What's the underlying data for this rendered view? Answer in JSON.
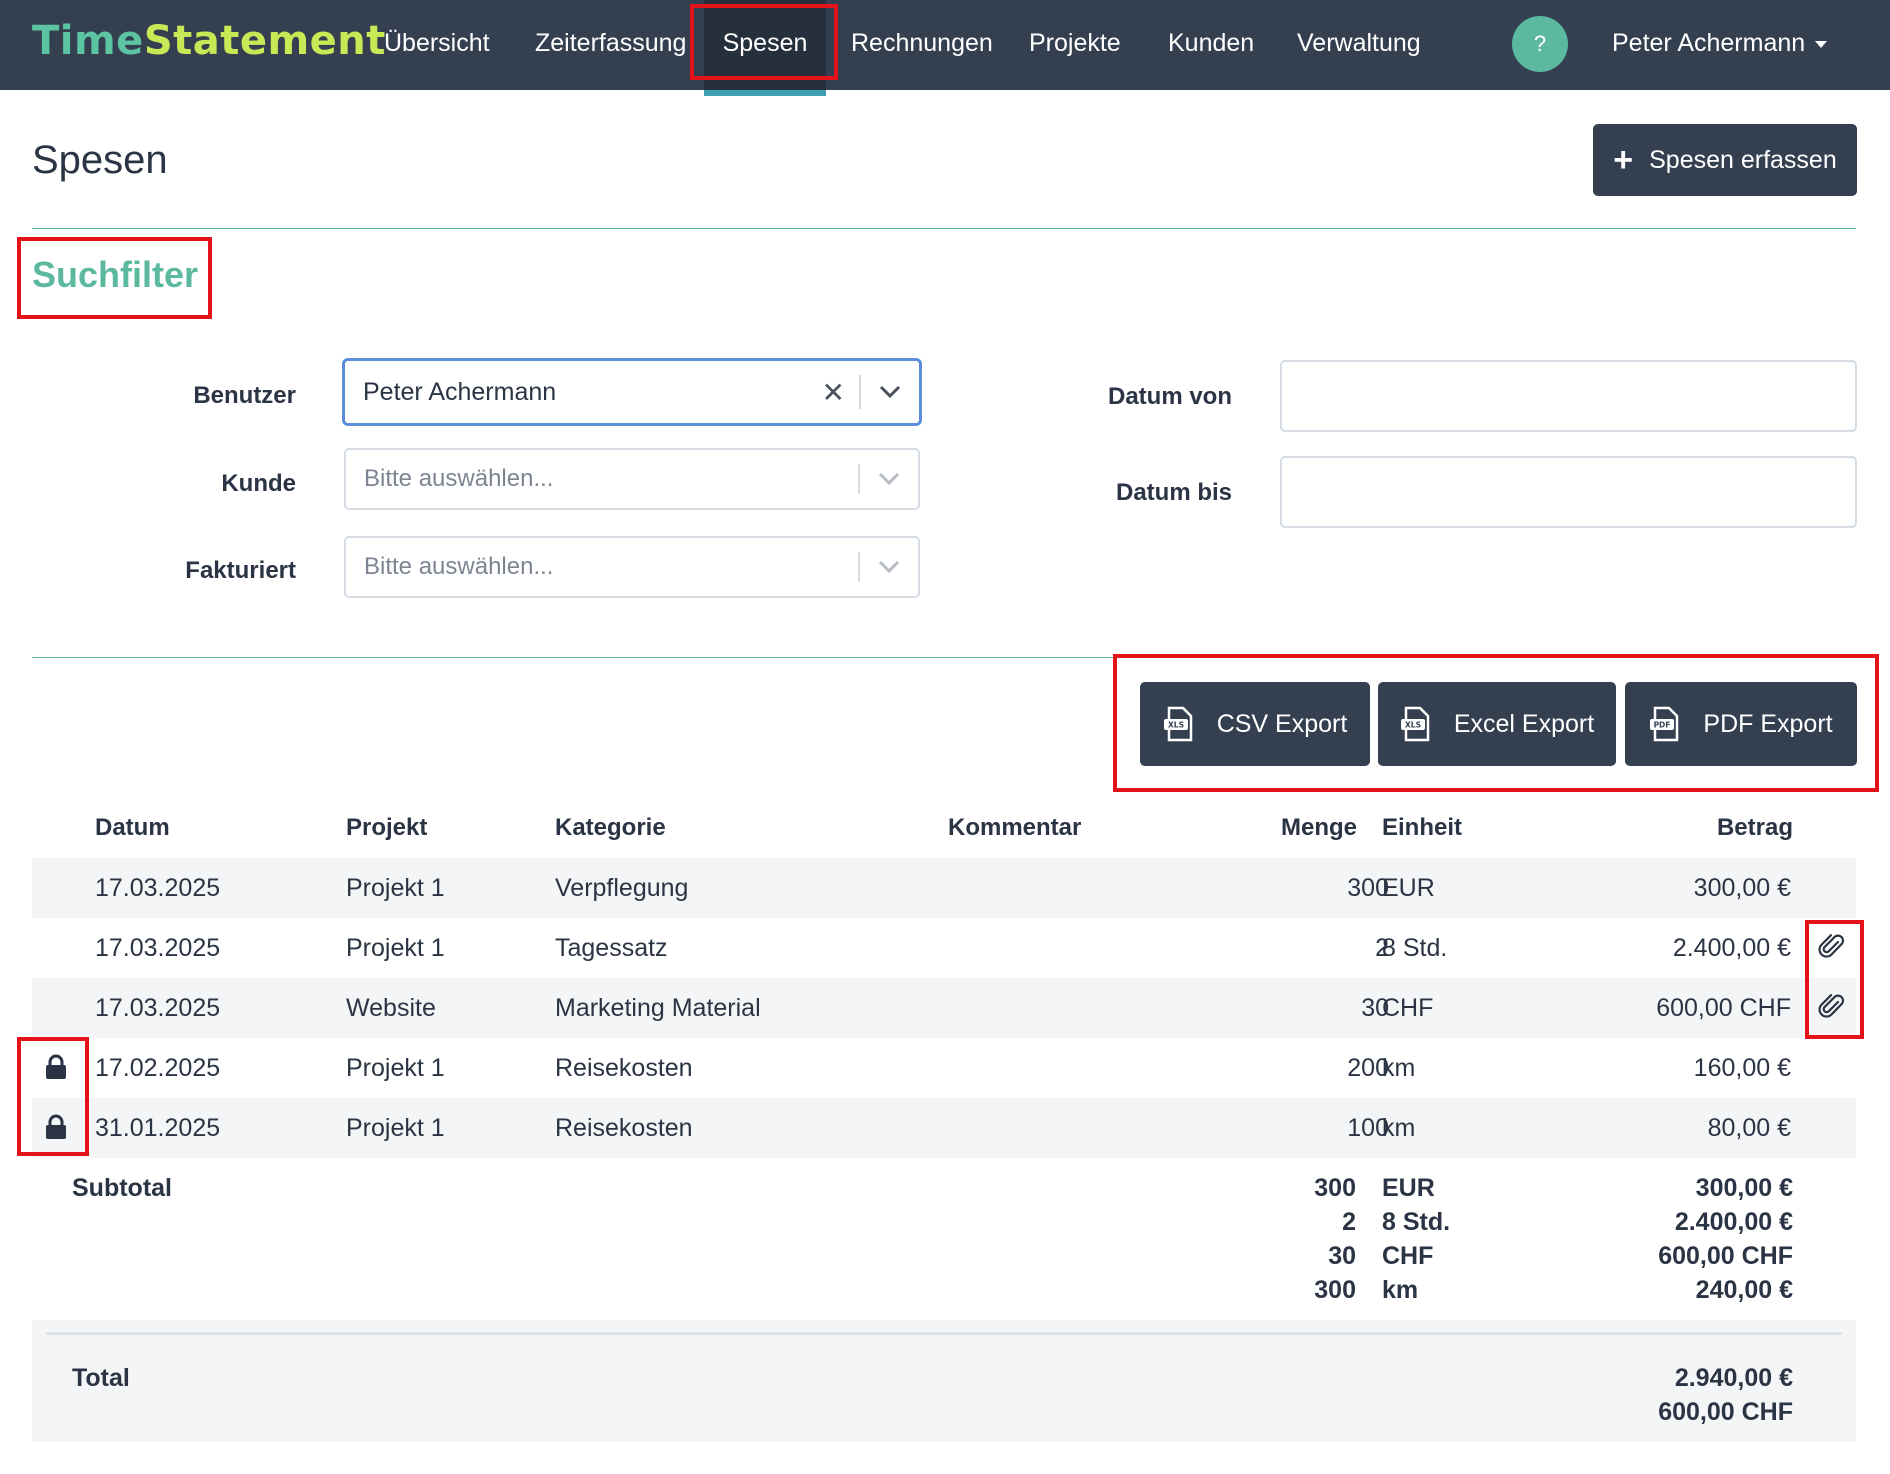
{
  "brand": {
    "part1": "Time",
    "part2": "Statement"
  },
  "nav": {
    "items": [
      "Übersicht",
      "Zeiterfassung",
      "Spesen",
      "Rechnungen",
      "Projekte",
      "Kunden",
      "Verwaltung"
    ],
    "active": "Spesen",
    "help_label": "?",
    "user_name": "Peter Achermann"
  },
  "page": {
    "title": "Spesen",
    "add_button": "Spesen erfassen"
  },
  "filter": {
    "title": "Suchfilter",
    "user_label": "Benutzer",
    "user_value": "Peter Achermann",
    "customer_label": "Kunde",
    "customer_placeholder": "Bitte auswählen...",
    "invoiced_label": "Fakturiert",
    "invoiced_placeholder": "Bitte auswählen...",
    "date_from_label": "Datum von",
    "date_from_value": "",
    "date_to_label": "Datum bis",
    "date_to_value": ""
  },
  "exports": {
    "csv": "CSV Export",
    "excel": "Excel Export",
    "pdf": "PDF Export",
    "xls_tag": "XLS",
    "pdf_tag": "PDF"
  },
  "table": {
    "headers": {
      "date": "Datum",
      "project": "Projekt",
      "category": "Kategorie",
      "comment": "Kommentar",
      "quantity": "Menge",
      "unit": "Einheit",
      "amount": "Betrag"
    },
    "rows": [
      {
        "date": "17.03.2025",
        "project": "Projekt 1",
        "category": "Verpflegung",
        "comment": "",
        "quantity": "300",
        "unit": "EUR",
        "amount": "300,00 €",
        "locked": false,
        "attachment": false
      },
      {
        "date": "17.03.2025",
        "project": "Projekt 1",
        "category": "Tagessatz",
        "comment": "",
        "quantity": "2",
        "unit": "8 Std.",
        "amount": "2.400,00 €",
        "locked": false,
        "attachment": true
      },
      {
        "date": "17.03.2025",
        "project": "Website",
        "category": "Marketing Material",
        "comment": "",
        "quantity": "30",
        "unit": "CHF",
        "amount": "600,00 CHF",
        "locked": false,
        "attachment": true
      },
      {
        "date": "17.02.2025",
        "project": "Projekt 1",
        "category": "Reisekosten",
        "comment": "",
        "quantity": "200",
        "unit": "km",
        "amount": "160,00 €",
        "locked": true,
        "attachment": false
      },
      {
        "date": "31.01.2025",
        "project": "Projekt 1",
        "category": "Reisekosten",
        "comment": "",
        "quantity": "100",
        "unit": "km",
        "amount": "80,00 €",
        "locked": true,
        "attachment": false
      }
    ],
    "subtotal_label": "Subtotal",
    "subtotals": [
      {
        "quantity": "300",
        "unit": "EUR",
        "amount": "300,00 €"
      },
      {
        "quantity": "2",
        "unit": "8 Std.",
        "amount": "2.400,00 €"
      },
      {
        "quantity": "30",
        "unit": "CHF",
        "amount": "600,00 CHF"
      },
      {
        "quantity": "300",
        "unit": "km",
        "amount": "240,00 €"
      }
    ],
    "total_label": "Total",
    "totals": [
      "2.940,00 €",
      "600,00 CHF"
    ]
  },
  "colors": {
    "navbar": "#343f50",
    "accent": "#5cb99f",
    "brand_green": "#c9e855",
    "highlight": "#e41219"
  }
}
